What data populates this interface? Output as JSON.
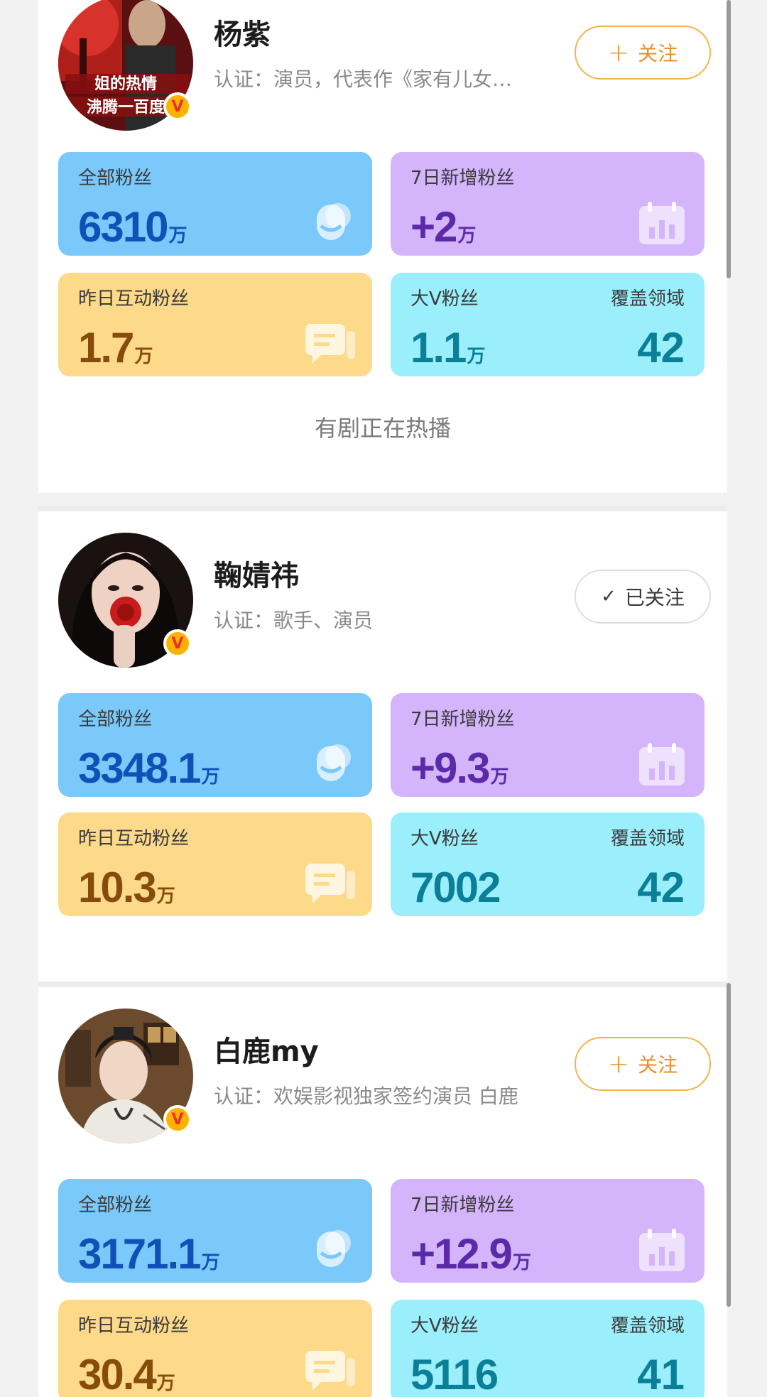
{
  "stat_labels": {
    "all_fans": "全部粉丝",
    "new_7d": "7日新增粉丝",
    "interact_yesterday": "昨日互动粉丝",
    "big_v": "大V粉丝",
    "coverage": "覆盖领域",
    "unit": "万"
  },
  "follow_label": "关注",
  "followed_label": "已关注",
  "accent_colors": {
    "follow": "#e8922a",
    "tile_blue": "#7bc8fb",
    "tile_purple": "#d4b4fb",
    "tile_yellow": "#fdd98a",
    "tile_cyan": "#9beefb"
  },
  "users": [
    {
      "name": "杨紫",
      "cert": "认证：演员，代表作《家有儿女…",
      "avatar_text": "姐的热情 沸腾一百度",
      "follow_state": "not_followed",
      "all_fans": "6310",
      "new_7d": "+2",
      "interact_yesterday": "1.7",
      "big_v": "1.1",
      "big_v_unit": "万",
      "coverage": "42",
      "tag": "有剧正在热播"
    },
    {
      "name": "鞠婧祎",
      "cert": "认证：歌手、演员",
      "follow_state": "followed",
      "all_fans": "3348.1",
      "new_7d": "+9.3",
      "interact_yesterday": "10.3",
      "big_v": "7002",
      "coverage": "42"
    },
    {
      "name": "白鹿my",
      "cert": "认证：欢娱影视独家签约演员 白鹿",
      "follow_state": "not_followed",
      "all_fans": "3171.1",
      "new_7d": "+12.9",
      "interact_yesterday": "30.4",
      "big_v": "5116",
      "coverage": "41"
    }
  ]
}
